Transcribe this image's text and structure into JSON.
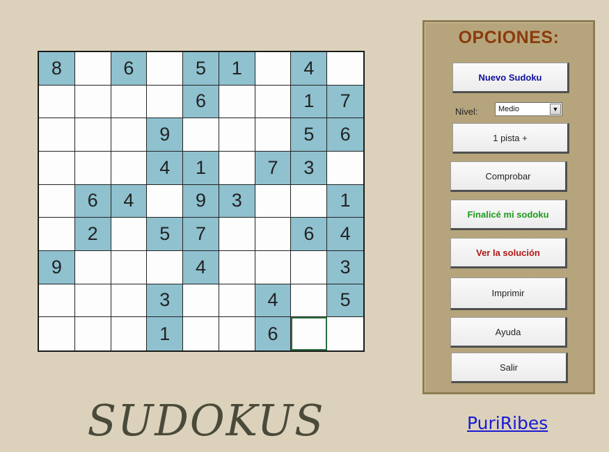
{
  "board": {
    "cells": [
      [
        8,
        null,
        6,
        null,
        5,
        1,
        null,
        4,
        null
      ],
      [
        null,
        null,
        null,
        null,
        6,
        null,
        null,
        1,
        7
      ],
      [
        null,
        null,
        null,
        9,
        null,
        null,
        null,
        5,
        6
      ],
      [
        null,
        null,
        null,
        4,
        1,
        null,
        7,
        3,
        null
      ],
      [
        null,
        6,
        4,
        null,
        9,
        3,
        null,
        null,
        1
      ],
      [
        null,
        2,
        null,
        5,
        7,
        null,
        null,
        6,
        4
      ],
      [
        9,
        null,
        null,
        null,
        4,
        null,
        null,
        null,
        3
      ],
      [
        null,
        null,
        null,
        3,
        null,
        null,
        4,
        null,
        5
      ],
      [
        null,
        null,
        null,
        1,
        null,
        null,
        6,
        null,
        null
      ]
    ],
    "selected_cell": [
      8,
      7
    ],
    "given_color": "#8fc1cf"
  },
  "options": {
    "title": "OPCIONES:",
    "nuevo_sudoku": "Nuevo Sudoku",
    "nivel_label": "Nivel:",
    "nivel_value": "Medio",
    "pista": "1 pista +",
    "comprobar": "Comprobar",
    "finalice": "Finalicé mi sodoku",
    "ver_solucion": "Ver la solución",
    "imprimir": "Imprimir",
    "ayuda": "Ayuda",
    "salir": "Salir"
  },
  "footer": {
    "title": "SUDOKUS",
    "author": "PuriRibes"
  },
  "colors": {
    "background": "#dcd2bb",
    "panel": "#b6a57c",
    "title": "#8a3b0b",
    "nuevo": "#1010a0",
    "finalice": "#1f9a1f",
    "ver": "#b01515",
    "link": "#1a1ad0"
  }
}
